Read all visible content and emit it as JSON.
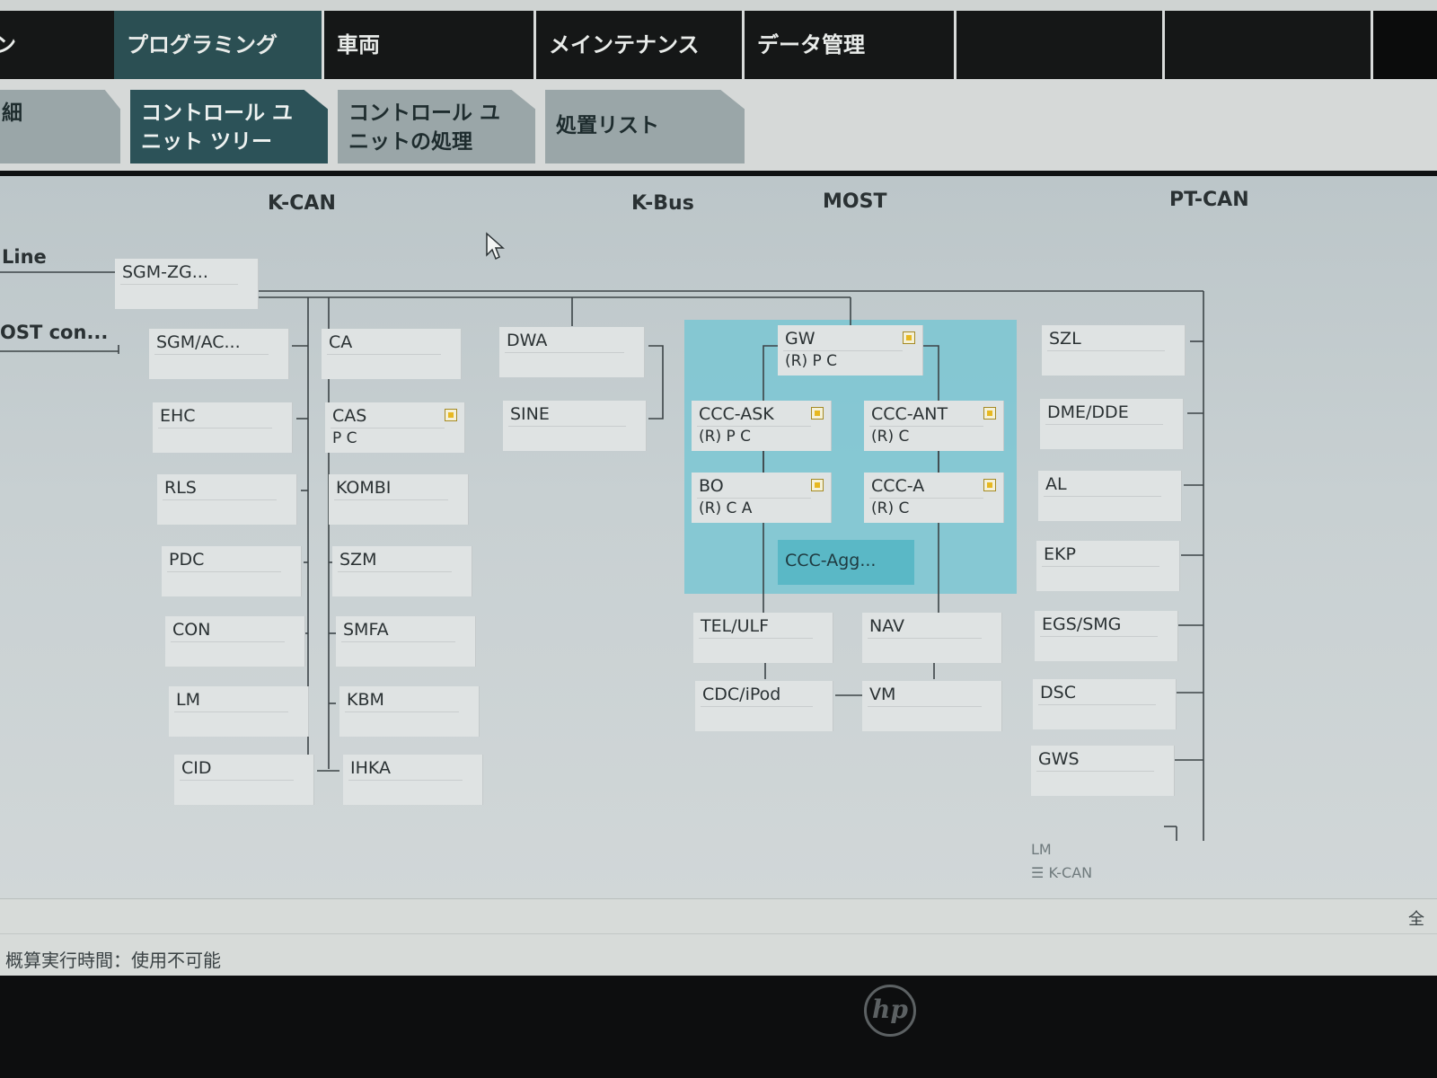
{
  "main_tabs": [
    {
      "label": "ン",
      "active": false
    },
    {
      "label": "プログラミング",
      "active": true
    },
    {
      "label": "車両",
      "active": false
    },
    {
      "label": "メインテナンス",
      "active": false
    },
    {
      "label": "データ管理",
      "active": false
    },
    {
      "label": "",
      "active": false
    },
    {
      "label": "",
      "active": false
    }
  ],
  "sub_tabs": [
    {
      "label": "細",
      "active": false
    },
    {
      "label": "コントロール ユ\nニット ツリー",
      "active": true
    },
    {
      "label": "コントロール ユ\nニットの処理",
      "active": false
    },
    {
      "label": "処置リスト",
      "active": false
    }
  ],
  "bus_labels": {
    "kcan": "K-CAN",
    "kbus": "K-Bus",
    "most": "MOST",
    "ptcan": "PT-CAN"
  },
  "side_labels": {
    "line": "Line",
    "most_con": "OST con..."
  },
  "gateway": {
    "name": "SGM-ZG..."
  },
  "kcan_left": [
    "SGM/AC...",
    "EHC",
    "RLS",
    "PDC",
    "CON",
    "LM",
    "CID"
  ],
  "kcan_right": [
    {
      "name": "CA",
      "status": ""
    },
    {
      "name": "CAS",
      "status": "P C",
      "flag": true
    },
    {
      "name": "KOMBI",
      "status": ""
    },
    {
      "name": "SZM",
      "status": ""
    },
    {
      "name": "SMFA",
      "status": ""
    },
    {
      "name": "KBM",
      "status": ""
    },
    {
      "name": "IHKA",
      "status": ""
    }
  ],
  "kbus": [
    "DWA",
    "SINE"
  ],
  "most": {
    "gw": {
      "name": "GW",
      "status": "(R) P C"
    },
    "ccc_ask": {
      "name": "CCC-ASK",
      "status": "(R) P C"
    },
    "ccc_ant": {
      "name": "CCC-ANT",
      "status": "(R) C"
    },
    "bo": {
      "name": "BO",
      "status": "(R) C A"
    },
    "ccc_a": {
      "name": "CCC-A",
      "status": "(R) C"
    },
    "ccc_agg": "CCC-Agg...",
    "tel": "TEL/ULF",
    "nav": "NAV",
    "cdc": "CDC/iPod",
    "vm": "VM"
  },
  "ptcan": [
    "SZL",
    "DME/DDE",
    "AL",
    "EKP",
    "EGS/SMG",
    "DSC",
    "GWS"
  ],
  "legend": {
    "lm": "LM",
    "kcan": "K-CAN"
  },
  "footer": {
    "estimate": "概算実行時間：使用不可能",
    "all": "全"
  },
  "bezel": {
    "logo": "hp"
  }
}
